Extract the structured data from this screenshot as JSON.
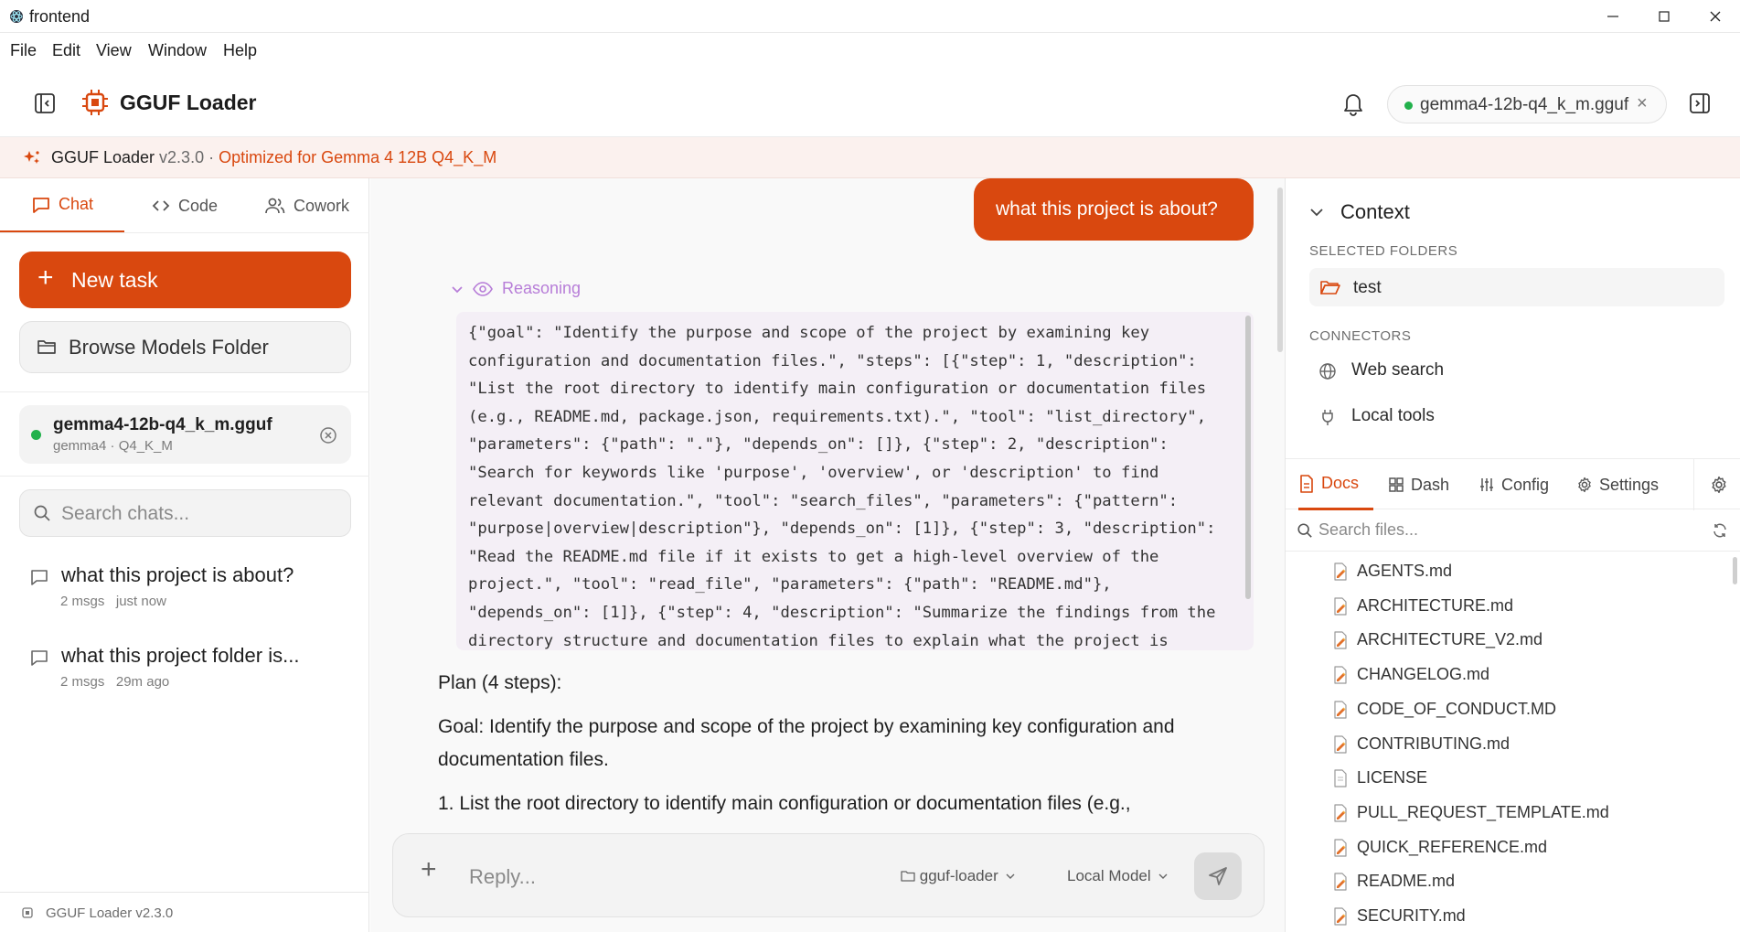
{
  "window": {
    "title": "frontend"
  },
  "menu": [
    "File",
    "Edit",
    "View",
    "Window",
    "Help"
  ],
  "header": {
    "app_name": "GGUF Loader",
    "model_pill": "gemma4-12b-q4_k_m.gguf",
    "model_pill_close": "×"
  },
  "banner": {
    "name": "GGUF Loader",
    "version": " v2.3.0 · ",
    "optimized": "Optimized for Gemma 4 12B Q4_K_M"
  },
  "sidebar": {
    "tabs": [
      {
        "label": "Chat"
      },
      {
        "label": "Code"
      },
      {
        "label": "Cowork"
      }
    ],
    "new_task": "New task",
    "browse": "Browse Models Folder",
    "model": {
      "name": "gemma4-12b-q4_k_m.gguf",
      "sub": "gemma4 · Q4_K_M"
    },
    "search_placeholder": "Search chats...",
    "chats": [
      {
        "title": "what this project is about?",
        "msgs": "2 msgs",
        "time": "just now"
      },
      {
        "title": "what this project folder is...",
        "msgs": "2 msgs",
        "time": "29m ago"
      }
    ],
    "footer": "GGUF Loader v2.3.0"
  },
  "conversation": {
    "user_message": "what this project is about?",
    "reasoning_label": "Reasoning",
    "reasoning_text": "{\"goal\": \"Identify the purpose and scope of the project by examining key\nconfiguration and documentation files.\", \"steps\": [{\"step\": 1, \"description\":\n\"List the root directory to identify main configuration or documentation files\n(e.g., README.md, package.json, requirements.txt).\", \"tool\": \"list_directory\",\n\"parameters\": {\"path\": \".\"}, \"depends_on\": []}, {\"step\": 2, \"description\":\n\"Search for keywords like 'purpose', 'overview', or 'description' to find\nrelevant documentation.\", \"tool\": \"search_files\", \"parameters\": {\"pattern\":\n\"purpose|overview|description\"}, \"depends_on\": [1]}, {\"step\": 3, \"description\":\n\"Read the README.md file if it exists to get a high-level overview of the\nproject.\", \"tool\": \"read_file\", \"parameters\": {\"path\": \"README.md\"},\n\"depends_on\": [1]}, {\"step\": 4, \"description\": \"Summarize the findings from the\ndirectory structure and documentation files to explain what the project is",
    "plan_title": "Plan (4 steps):",
    "goal_line1": "Goal: Identify the purpose and scope of the project by examining key configuration and",
    "goal_line2": "documentation files.",
    "step1": "1. List the root directory to identify main configuration or documentation files (e.g.,"
  },
  "composer": {
    "placeholder": "Reply...",
    "project": "gguf-loader",
    "model": "Local Model"
  },
  "context": {
    "title": "Context",
    "selected_folders_label": "SELECTED FOLDERS",
    "folder": "test",
    "connectors_label": "CONNECTORS",
    "connectors": [
      "Web search",
      "Local tools"
    ]
  },
  "files_panel": {
    "tabs": [
      "Docs",
      "Dash",
      "Config",
      "Settings"
    ],
    "search_placeholder": "Search files...",
    "files": [
      "AGENTS.md",
      "ARCHITECTURE.md",
      "ARCHITECTURE_V2.md",
      "CHANGELOG.md",
      "CODE_OF_CONDUCT.MD",
      "CONTRIBUTING.md",
      "LICENSE",
      "PULL_REQUEST_TEMPLATE.md",
      "QUICK_REFERENCE.md",
      "README.md",
      "SECURITY.md"
    ]
  },
  "colors": {
    "accent": "#d9480f",
    "status_green": "#22b14c",
    "reasoning": "#b77dd8"
  }
}
